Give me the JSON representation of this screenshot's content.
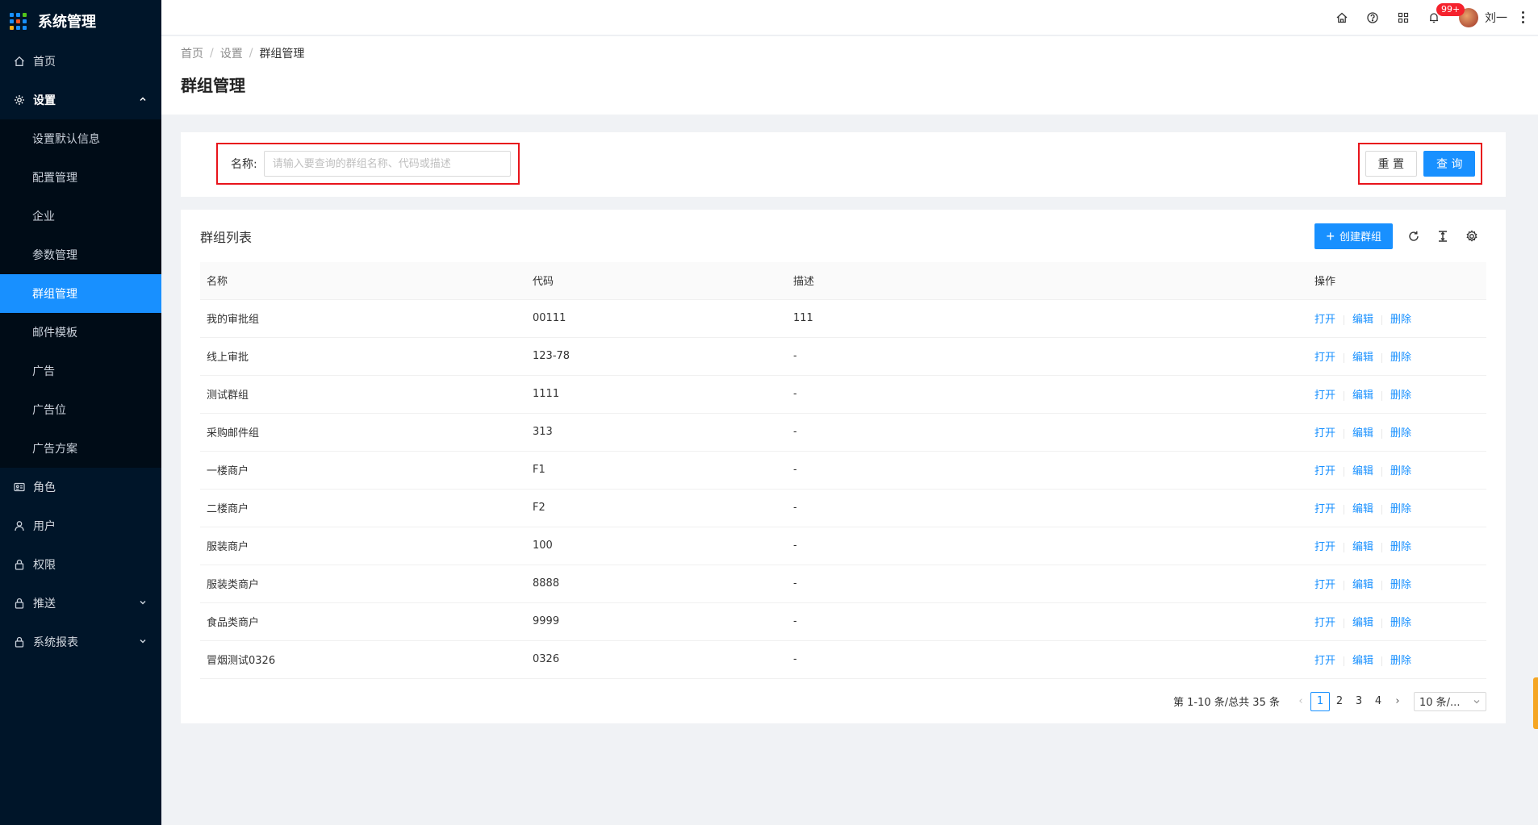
{
  "app": {
    "title": "系统管理"
  },
  "sidebar": {
    "items": [
      {
        "label": "首页",
        "icon": "home-icon"
      },
      {
        "label": "设置",
        "icon": "gear-icon",
        "open": true,
        "children": [
          {
            "label": "设置默认信息"
          },
          {
            "label": "配置管理"
          },
          {
            "label": "企业"
          },
          {
            "label": "参数管理"
          },
          {
            "label": "群组管理",
            "active": true
          },
          {
            "label": "邮件模板"
          },
          {
            "label": "广告"
          },
          {
            "label": "广告位"
          },
          {
            "label": "广告方案"
          }
        ]
      },
      {
        "label": "角色",
        "icon": "id-card-icon"
      },
      {
        "label": "用户",
        "icon": "user-icon"
      },
      {
        "label": "权限",
        "icon": "lock-icon"
      },
      {
        "label": "推送",
        "icon": "lock-icon",
        "expandable": true
      },
      {
        "label": "系统报表",
        "icon": "lock-icon",
        "expandable": true
      }
    ]
  },
  "header": {
    "badge": "99+",
    "user_name": "刘一"
  },
  "breadcrumb": [
    "首页",
    "设置",
    "群组管理"
  ],
  "page_title": "群组管理",
  "search": {
    "label": "名称:",
    "placeholder": "请输入要查询的群组名称、代码或描述",
    "value": "",
    "reset_label": "重 置",
    "query_label": "查 询"
  },
  "table_card": {
    "title": "群组列表",
    "create_label": "创建群组",
    "columns": [
      "名称",
      "代码",
      "描述",
      "操作"
    ],
    "actions": [
      "打开",
      "编辑",
      "删除"
    ],
    "rows": [
      {
        "name": "我的审批组",
        "code": "00111",
        "desc": "111"
      },
      {
        "name": "线上审批",
        "code": "123-78",
        "desc": "-"
      },
      {
        "name": "测试群组",
        "code": "1111",
        "desc": "-"
      },
      {
        "name": "采购邮件组",
        "code": "313",
        "desc": "-"
      },
      {
        "name": "一楼商户",
        "code": "F1",
        "desc": "-"
      },
      {
        "name": "二楼商户",
        "code": "F2",
        "desc": "-"
      },
      {
        "name": "服装商户",
        "code": "100",
        "desc": "-"
      },
      {
        "name": "服装类商户",
        "code": "8888",
        "desc": "-"
      },
      {
        "name": "食品类商户",
        "code": "9999",
        "desc": "-"
      },
      {
        "name": "冒烟测试0326",
        "code": "0326",
        "desc": "-"
      }
    ]
  },
  "pagination": {
    "total_text": "第 1-10 条/总共 35 条",
    "pages": [
      "1",
      "2",
      "3",
      "4"
    ],
    "current": "1",
    "page_size": "10 条/..."
  },
  "colors": {
    "sidebar_bg": "#001529",
    "primary": "#1890ff",
    "highlight_border": "#e8141b",
    "badge": "#f5222d"
  }
}
